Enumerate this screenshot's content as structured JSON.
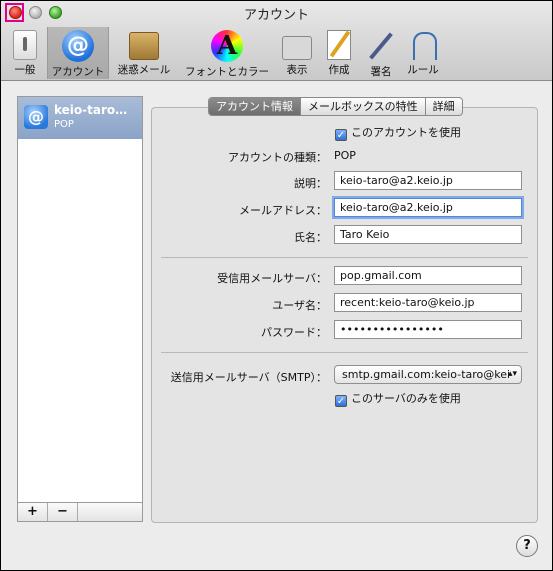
{
  "window": {
    "title": "アカウント"
  },
  "toolbar": [
    {
      "id": "general",
      "label": "一般"
    },
    {
      "id": "accounts",
      "label": "アカウント"
    },
    {
      "id": "junk",
      "label": "迷惑メール"
    },
    {
      "id": "fonts",
      "label": "フォントとカラー"
    },
    {
      "id": "view",
      "label": "表示"
    },
    {
      "id": "compose",
      "label": "作成"
    },
    {
      "id": "signatures",
      "label": "署名"
    },
    {
      "id": "rules",
      "label": "ルール"
    }
  ],
  "sidebar": {
    "account_name": "keio-taro…",
    "account_type": "POP",
    "add_label": "+",
    "remove_label": "−"
  },
  "tabs": [
    "アカウント情報",
    "メールボックスの特性",
    "詳細"
  ],
  "form": {
    "enable_label": "このアカウントを使用",
    "account_type_label": "アカウントの種類：",
    "account_type_value": "POP",
    "description_label": "説明：",
    "description_value": "keio-taro@a2.keio.jp",
    "email_label": "メールアドレス：",
    "email_value": "keio-taro@a2.keio.jp",
    "fullname_label": "氏名：",
    "fullname_value": "Taro Keio",
    "incoming_label": "受信用メールサーバ：",
    "incoming_value": "pop.gmail.com",
    "username_label": "ユーザ名：",
    "username_value": "recent:keio-taro@keio.jp",
    "password_label": "パスワード：",
    "password_value": "••••••••••••••••",
    "outgoing_label": "送信用メールサーバ（SMTP）：",
    "outgoing_value": "smtp.gmail.com:keio-taro@kei",
    "only_server_label": "このサーバのみを使用"
  },
  "help_label": "?",
  "colors": {
    "selection": "#8aa3c7",
    "accent": "#2f6fd4",
    "highlight": "#e0008a"
  }
}
